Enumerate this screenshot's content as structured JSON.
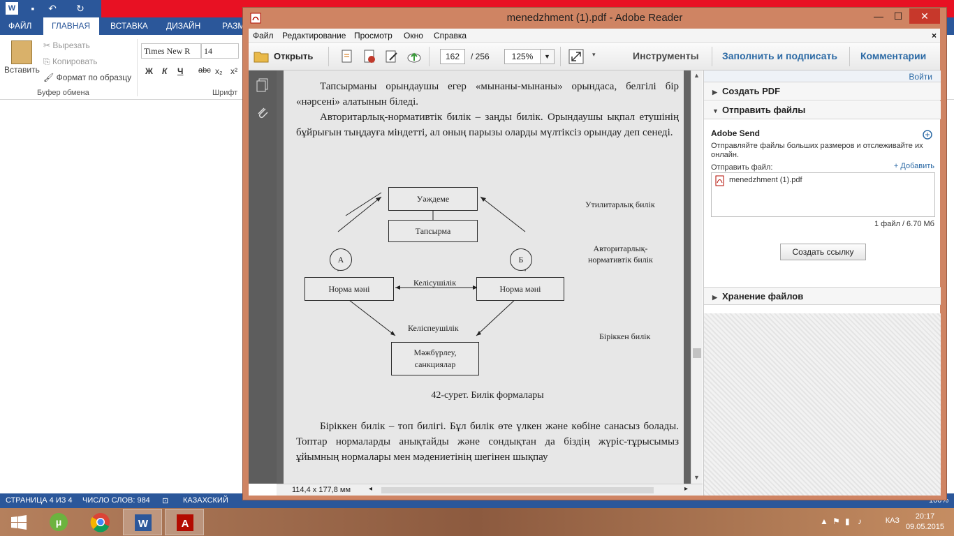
{
  "word": {
    "tabs": [
      "ФАЙЛ",
      "ГЛАВНАЯ",
      "ВСТАВКА",
      "ДИЗАЙН",
      "РАЗМ"
    ],
    "active_tab": "ГЛАВНАЯ",
    "clipboard": {
      "paste": "Вставить",
      "cut": "Вырезать",
      "copy": "Копировать",
      "format_painter": "Формат по образцу",
      "group_label": "Буфер обмена"
    },
    "font": {
      "family": "Times New R",
      "size": "14",
      "group_label": "Шрифт",
      "bold": "Ж",
      "italic": "К",
      "underline": "Ч",
      "strike": "abc",
      "subscript": "x₂",
      "superscript": "x²"
    },
    "status": {
      "page": "СТРАНИЦА 4 ИЗ 4",
      "words": "ЧИСЛО СЛОВ: 984",
      "language": "КАЗАХСКИЙ",
      "zoom": "100%"
    }
  },
  "reader": {
    "title": "menedzhment (1).pdf - Adobe Reader",
    "menu": [
      "Файл",
      "Редактирование",
      "Просмотр",
      "Окно",
      "Справка"
    ],
    "toolbar": {
      "open": "Открыть",
      "page_current": "162",
      "page_total": "/ 256",
      "zoom": "125%",
      "tools": "Инструменты",
      "fill_sign": "Заполнить и подписать",
      "comments": "Комментарии"
    },
    "page": {
      "para1": "Тапсырманы орындаушы егер «мынаны-мынаны» орындаса, белгілі бір «нәрсені» алатынын біледі.",
      "para2": "Авторитарлық-нормативтік билік – заңды билік. Орындаушы ықпал етушінің бұйрығын тыңдауға міндетті, ал оның парызы оларды мүлтіксіз орындау деп сенеді.",
      "diagram": {
        "top_box": "Уәждеме",
        "task_box": "Тапсырма",
        "circle_a": "А",
        "circle_b": "Б",
        "norm_left": "Норма мәні",
        "norm_right": "Норма мәні",
        "agreement": "Келісушілік",
        "disagreement": "Келіспеушілік",
        "coercion_line1": "Мәжбүрлеу,",
        "coercion_line2": "санкциялар",
        "label_utilitarian": "Утилитарлық билік",
        "label_authoritarian_1": "Авторитарлық-",
        "label_authoritarian_2": "нормативтік билік",
        "label_combined": "Біріккен билік"
      },
      "caption": "42-сурет. Билік формалары",
      "para3": "Біріккен билік – топ билігі. Бұл билік өте үлкен және көбіне санасыз болады. Топтар нормаларды анықтайды және сондықтан да біздің жүріс-тұрысымыз ұйымның нормалары мен мәдениетінің шегінен шықпау"
    },
    "page_size": "114,4 x 177,8 мм",
    "right_pane": {
      "sign_in": "Войти",
      "create_pdf": "Создать PDF",
      "send_files": "Отправить файлы",
      "adobe_send": "Adobe Send",
      "send_desc": "Отправляйте файлы больших размеров и отслеживайте их онлайн.",
      "send_file_label": "Отправить файл:",
      "add": "+ Добавить",
      "file_name": "menedzhment (1).pdf",
      "file_info": "1 файл / 6.70 Мб",
      "create_link": "Создать ссылку",
      "file_storage": "Хранение файлов"
    }
  },
  "taskbar": {
    "lang": "КАЗ",
    "time": "20:17",
    "date": "09.05.2015"
  }
}
